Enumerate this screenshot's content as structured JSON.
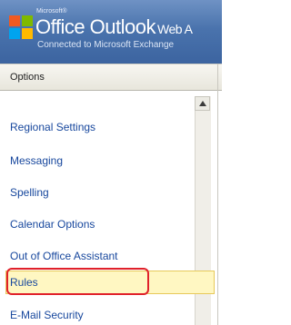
{
  "header": {
    "brand_ms": "Microsoft®",
    "brand_office": "Office Outlook",
    "brand_webaccess": "Web A",
    "subtitle": "Connected to Microsoft Exchange"
  },
  "options": {
    "title": "Options"
  },
  "nav": {
    "items": [
      {
        "label": "Regional Settings"
      },
      {
        "label": "Messaging"
      },
      {
        "label": "Spelling"
      },
      {
        "label": "Calendar Options"
      },
      {
        "label": "Out of Office Assistant"
      },
      {
        "label": "Rules",
        "selected": true
      },
      {
        "label": "E-Mail Security"
      }
    ]
  },
  "colors": {
    "header_bg": "#4a73ad",
    "link": "#17479d",
    "selected_bg": "#fff7c2",
    "highlight_outline": "#e0212a"
  }
}
